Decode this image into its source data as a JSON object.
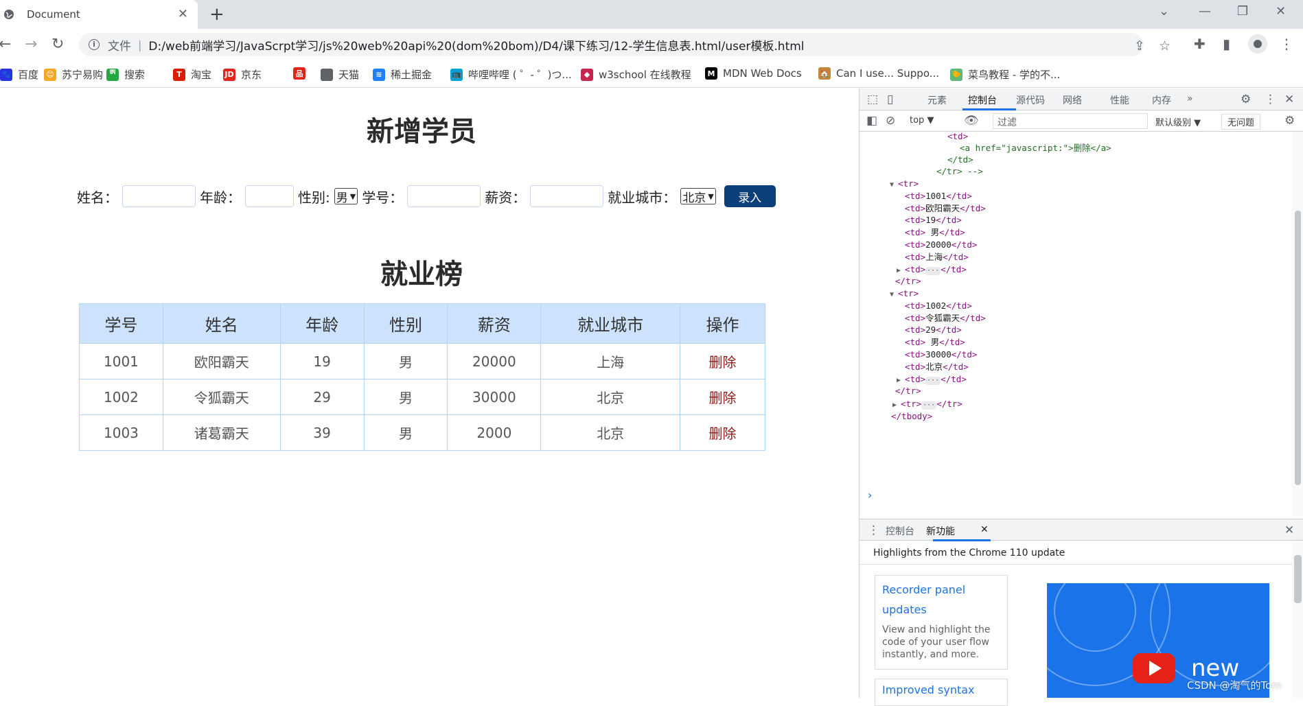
{
  "browser": {
    "tab_title": "Document",
    "url_scheme_label": "文件",
    "url": "D:/web前端学习/JavaScrpt学习/js%20web%20api%20(dom%20bom)/D4/课下练习/12-学生信息表.html/user模板.html",
    "bookmarks": [
      {
        "label": "百度",
        "icon": "baidu-icon",
        "color": "#2932e1"
      },
      {
        "label": "苏宁易购",
        "icon": "suning-icon",
        "color": "#f5a623"
      },
      {
        "label": "搜索",
        "icon": "search-bookmark-icon",
        "color": "#27a844"
      },
      {
        "label": "淘宝",
        "icon": "taobao-icon",
        "color": "#d81e06"
      },
      {
        "label": "京东",
        "icon": "jd-icon",
        "color": "#e1251b"
      },
      {
        "label": "",
        "icon": "apps-icon",
        "color": "#e1251b"
      },
      {
        "label": "天猫",
        "icon": "globe-icon",
        "color": "#5f6368"
      },
      {
        "label": "稀土掘金",
        "icon": "juejin-icon",
        "color": "#1e80ff"
      },
      {
        "label": "哔哩哔哩 ( ゜- ゜)つ...",
        "icon": "bilibili-icon",
        "color": "#00a1d6"
      },
      {
        "label": "w3school 在线教程",
        "icon": "w3school-icon",
        "color": "#c7254e"
      },
      {
        "label": "MDN Web Docs",
        "icon": "mdn-icon",
        "color": "#000000"
      },
      {
        "label": "Can I use... Suppo...",
        "icon": "caniuse-icon",
        "color": "#c2873b"
      },
      {
        "label": "菜鸟教程 - 学的不...",
        "icon": "runoob-icon",
        "color": "#5fb878"
      }
    ]
  },
  "page": {
    "form_title": "新增学员",
    "form": {
      "name_label": "姓名：",
      "age_label": "年龄：",
      "gender_label": "性别:",
      "gender_value": "男",
      "id_label": "学号：",
      "salary_label": "薪资：",
      "city_label": "就业城市：",
      "city_value": "北京",
      "submit_label": "录入"
    },
    "table_title": "就业榜",
    "table": {
      "headers": [
        "学号",
        "姓名",
        "年龄",
        "性别",
        "薪资",
        "就业城市",
        "操作"
      ],
      "rows": [
        [
          "1001",
          "欧阳霸天",
          "19",
          "男",
          "20000",
          "上海",
          "删除"
        ],
        [
          "1002",
          "令狐霸天",
          "29",
          "男",
          "30000",
          "北京",
          "删除"
        ],
        [
          "1003",
          "诸葛霸天",
          "39",
          "男",
          "2000",
          "北京",
          "删除"
        ]
      ]
    }
  },
  "devtools": {
    "tabs": [
      "元素",
      "控制台",
      "源代码",
      "网络",
      "性能",
      "内存"
    ],
    "active_tab": "控制台",
    "context": "top",
    "filter_placeholder": "过滤",
    "level": "默认级别",
    "issues": "无问题",
    "code": {
      "l0": "<td>",
      "l1_a_open": "<a href=\"javascript:\">",
      "l1_text": "删除",
      "l1_a_close": "</a>",
      "l2": "</td>",
      "l3": "</tr> -->",
      "tr_open": "<tr>",
      "tr_close": "</tr>",
      "tbody_close": "</tbody>",
      "row1": [
        "1001",
        "欧阳霸天",
        "19",
        " 男",
        "20000",
        "上海"
      ],
      "row2": [
        "1002",
        "令狐霸天",
        "29",
        " 男",
        "30000",
        "北京"
      ]
    },
    "drawer_tabs": [
      "控制台",
      "新功能"
    ],
    "drawer_heading": "Highlights from the Chrome 110 update",
    "card_title": "Recorder panel updates",
    "card_desc": "View and highlight the code of your user flow instantly, and more.",
    "card2_title": "Improved syntax",
    "promo_text": "new"
  },
  "watermark": "CSDN @淘气的Tom"
}
